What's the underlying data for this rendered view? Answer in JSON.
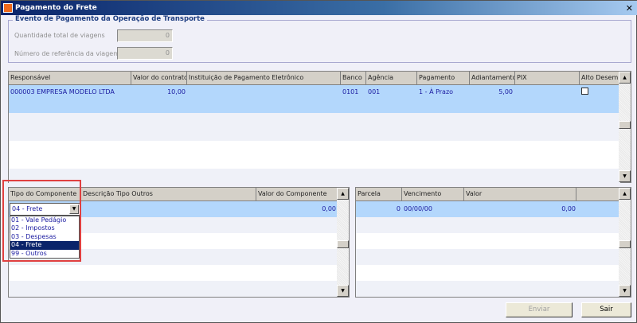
{
  "window": {
    "title": "Pagamento do Frete",
    "close": "✕"
  },
  "group": {
    "title": "Evento de Pagamento da Operação de Transporte",
    "fields": [
      {
        "label": "Quantidade total de viagens",
        "value": "0"
      },
      {
        "label": "Número de referência da viagem",
        "value": "0"
      }
    ]
  },
  "top_grid": {
    "headers": [
      "Responsável",
      "Valor do contrato",
      "Instituição de Pagamento Eletrônico",
      "Banco",
      "Agência",
      "Pagamento",
      "Adiantamento",
      "PIX",
      "Alto Desemp"
    ],
    "row": {
      "responsavel": "000003   EMPRESA MODELO LTDA",
      "valor": "10,00",
      "instituicao": "",
      "banco": "0101",
      "agencia": "001",
      "pagamento": "1 - À Prazo",
      "adiantamento": "5,00",
      "pix": "",
      "alto": false
    }
  },
  "comp_grid": {
    "headers": [
      "Tipo do Componente",
      "Descrição Tipo Outros",
      "Valor do Componente"
    ],
    "row": {
      "tipo": "04 - Frete",
      "descricao": "",
      "valor": "0,00"
    },
    "options": [
      "01 - Vale Pedágio",
      "02 - Impostos",
      "03 - Despesas",
      "04 - Frete",
      "99 - Outros"
    ],
    "selected_index": 3
  },
  "parc_grid": {
    "headers": [
      "Parcela",
      "Vencimento",
      "Valor",
      ""
    ],
    "row": {
      "parcela": "0",
      "vencimento": "00/00/00",
      "valor": "0,00"
    }
  },
  "buttons": {
    "enviar": "Enviar",
    "sair": "Sair"
  }
}
